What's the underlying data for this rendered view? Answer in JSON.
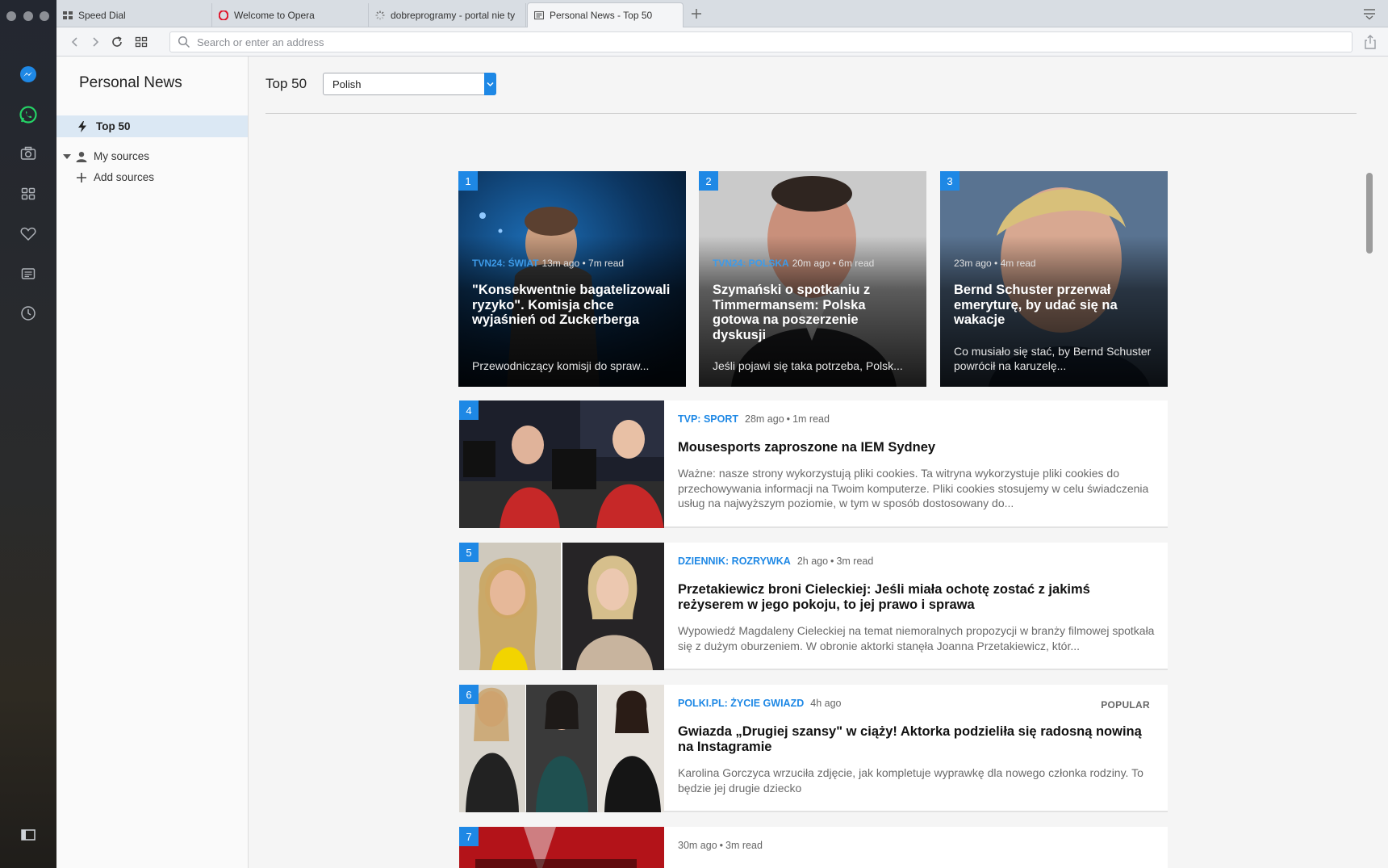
{
  "window": {
    "tabs": [
      {
        "label": "Speed Dial",
        "icon": "speed-dial-icon"
      },
      {
        "label": "Welcome to Opera",
        "icon": "opera-icon"
      },
      {
        "label": "dobreprogramy - portal nie ty",
        "icon": "loading-icon"
      },
      {
        "label": "Personal News - Top 50",
        "icon": "news-icon",
        "active": true
      }
    ],
    "address_placeholder": "Search or enter an address"
  },
  "sidebar": {
    "icons": [
      "messenger-icon",
      "whatsapp-icon",
      "camera-icon",
      "speed-dial-icon",
      "heart-icon",
      "news-icon",
      "history-icon",
      "sidebar-toggle-icon"
    ]
  },
  "news_nav": {
    "title": "Personal News",
    "top50_label": "Top 50",
    "my_sources_label": "My sources",
    "add_sources_label": "Add sources"
  },
  "main": {
    "title": "Top 50",
    "language": "Polish",
    "accent_color": "#1e88e5"
  },
  "featured": [
    {
      "rank": "1",
      "source": "TVN24: ŚWIAT",
      "time": "13m ago",
      "read": "7m read",
      "headline": "\"Konsekwentnie bagatelizowali ryzyko\". Komisja chce wyjaśnień od Zuckerberga",
      "lead": "Przewodniczący komisji do spraw..."
    },
    {
      "rank": "2",
      "source": "TVN24: POLSKA",
      "time": "20m ago",
      "read": "6m read",
      "headline": "Szymański o spotkaniu z Timmermansem: Polska gotowa na poszerzenie dyskusji",
      "lead": "Jeśli pojawi się taka potrzeba, Polsk..."
    },
    {
      "rank": "3",
      "source": "",
      "time": "23m ago",
      "read": "4m read",
      "headline": "Bernd Schuster przerwał emeryturę, by udać się na wakacje",
      "lead": "Co musiało się stać, by Bernd Schuster powrócił na karuzelę..."
    }
  ],
  "items": [
    {
      "rank": "4",
      "source": "TVP: SPORT",
      "time": "28m ago",
      "read": "1m read",
      "popular": "",
      "headline": "Mousesports zaproszone na IEM Sydney",
      "lead": "Ważne: nasze strony wykorzystują pliki cookies. Ta witryna wykorzystuje pliki cookies do przechowywania informacji na Twoim komputerze. Pliki cookies stosujemy w celu świadczenia usług na najwyższym poziomie, w tym w sposób dostosowany do..."
    },
    {
      "rank": "5",
      "source": "DZIENNIK: ROZRYWKA",
      "time": "2h ago",
      "read": "3m read",
      "popular": "",
      "headline": "Przetakiewicz broni Cieleckiej: Jeśli miała ochotę zostać z jakimś reżyserem w jego pokoju, to jej prawo i sprawa",
      "lead": "Wypowiedź Magdaleny Cieleckiej na temat niemoralnych propozycji w branży filmowej spotkała się z dużym oburzeniem. W obronie aktorki stanęła Joanna Przetakiewicz, któr..."
    },
    {
      "rank": "6",
      "source": "POLKI.PL: ŻYCIE GWIAZD",
      "time": "4h ago",
      "read": "",
      "popular": "POPULAR",
      "headline": "Gwiazda „Drugiej szansy\" w ciąży! Aktorka podzieliła się radosną nowiną na Instagramie",
      "lead": "Karolina Gorczyca wrzuciła zdjęcie, jak kompletuje wyprawkę dla nowego członka rodziny. To będzie jej drugie dziecko"
    },
    {
      "rank": "7",
      "source": "",
      "time": "30m ago",
      "read": "3m read",
      "popular": "",
      "headline": "",
      "lead": ""
    }
  ]
}
